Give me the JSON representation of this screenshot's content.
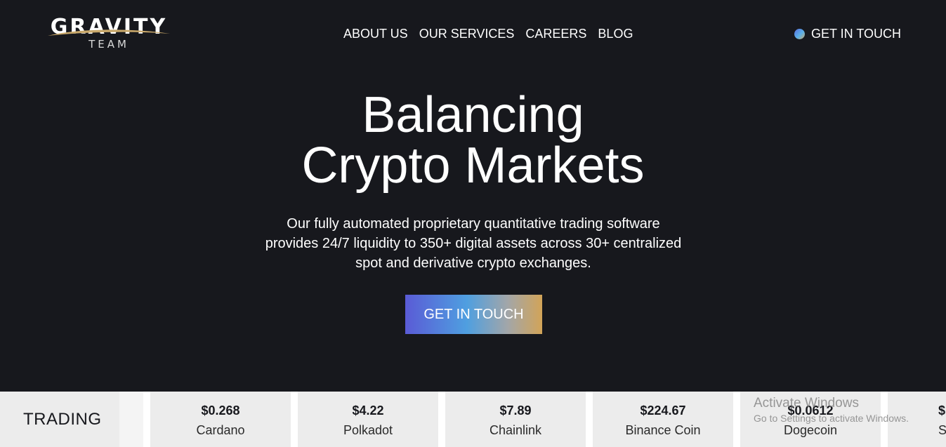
{
  "header": {
    "logo": {
      "word": "GRAVITY",
      "sub": "TEAM"
    },
    "nav": [
      {
        "label": "ABOUT US"
      },
      {
        "label": "OUR SERVICES"
      },
      {
        "label": "CAREERS"
      },
      {
        "label": "BLOG"
      }
    ],
    "cta_label": "GET IN TOUCH"
  },
  "hero": {
    "title_line1": "Balancing",
    "title_line2": "Crypto Markets",
    "subtitle": "Our fully automated proprietary quantitative trading software provides 24/7 liquidity to 350+ digital assets across 30+ centralized spot and derivative crypto exchanges.",
    "cta_label": "GET IN TOUCH"
  },
  "ticker": {
    "label": "TRADING",
    "items": [
      {
        "price": "$0.268",
        "name": "Cardano"
      },
      {
        "price": "$4.22",
        "name": "Polkadot"
      },
      {
        "price": "$7.89",
        "name": "Chainlink"
      },
      {
        "price": "$224.67",
        "name": "Binance Coin"
      },
      {
        "price": "$0.0612",
        "name": "Dogecoin"
      },
      {
        "price": "$",
        "name": "S"
      }
    ]
  },
  "os_overlay": {
    "title": "Activate Windows",
    "subtitle": "Go to Settings to activate Windows."
  },
  "colors": {
    "background": "#17181d",
    "ticker_tile": "#ececec",
    "cta_gradient": [
      "#5a5bd6",
      "#4f9fe0",
      "#a3a6a8",
      "#d2a458"
    ],
    "logo_accent": "#c9a86a"
  }
}
